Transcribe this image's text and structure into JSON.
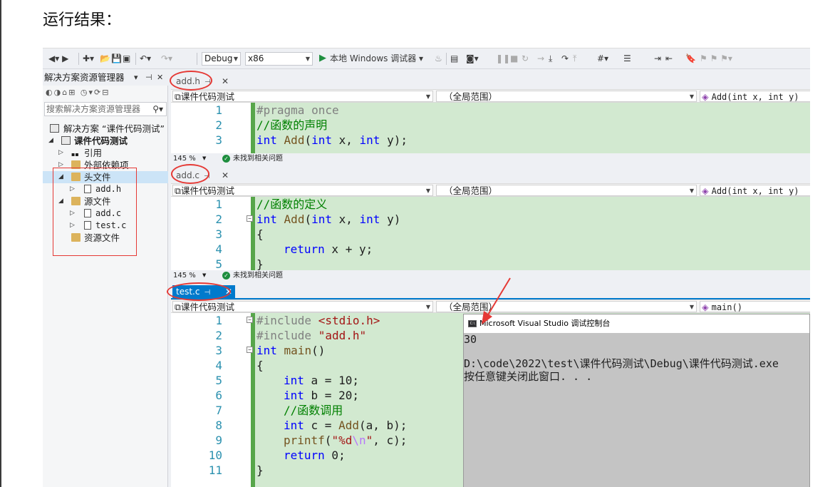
{
  "article_title": "运行结果：",
  "toolbar": {
    "config": "Debug",
    "platform": "x86",
    "run_label": "本地 Windows 调试器",
    "run_dropdown": "▾"
  },
  "solution_explorer": {
    "title": "解决方案资源管理器",
    "search_placeholder": "搜索解决方案资源管理器",
    "items": [
      {
        "label": "解决方案 “课件代码测试”",
        "bold": false
      },
      {
        "label": "课件代码测试",
        "bold": true
      },
      {
        "label": "引用",
        "bold": false
      },
      {
        "label": "外部依赖项",
        "bold": false
      },
      {
        "label": "头文件",
        "bold": false
      },
      {
        "label": "add.h",
        "bold": false
      },
      {
        "label": "源文件",
        "bold": false
      },
      {
        "label": "add.c",
        "bold": false
      },
      {
        "label": "test.c",
        "bold": false
      },
      {
        "label": "资源文件",
        "bold": false
      }
    ]
  },
  "panes": [
    {
      "tab": "add.h",
      "nav_project": "课件代码测试",
      "nav_scope": "（全局范围）",
      "nav_member": "Add(int x, int y)",
      "lines": [
        "1",
        "2",
        "3"
      ],
      "zoom": "145 %",
      "status": "未找到相关问题"
    },
    {
      "tab": "add.c",
      "nav_project": "课件代码测试",
      "nav_scope": "（全局范围）",
      "nav_member": "Add(int x, int y)",
      "lines": [
        "1",
        "2",
        "3",
        "4",
        "5"
      ],
      "zoom": "145 %",
      "status": "未找到相关问题"
    },
    {
      "tab": "test.c",
      "nav_project": "课件代码测试",
      "nav_scope": "（全局范围）",
      "nav_member": "main()",
      "lines": [
        "1",
        "2",
        "3",
        "4",
        "5",
        "6",
        "7",
        "8",
        "9",
        "10",
        "11"
      ]
    }
  ],
  "code": {
    "addh": {
      "l1": "#pragma once",
      "l2": "//函数的声明",
      "l3_kw1": "int",
      "l3_fn": "Add",
      "l3_a": "(",
      "l3_kw2": "int",
      "l3_b": " x, ",
      "l3_kw3": "int",
      "l3_c": " y);"
    },
    "addc": {
      "l1": "//函数的定义",
      "l2_kw1": "int",
      "l2_fn": "Add",
      "l2_a": "(",
      "l2_kw2": "int",
      "l2_b": " x, ",
      "l2_kw3": "int",
      "l2_c": " y)",
      "l3": "{",
      "l4_kw": "return",
      "l4_rest": " x + y;",
      "l5": "}"
    },
    "testc": {
      "l1_pp": "#include ",
      "l1_st": "<stdio.h>",
      "l2_pp": "#include ",
      "l2_st": "\"add.h\"",
      "l3_kw": "int",
      "l3_fn": " main",
      "l3_rest": "()",
      "l4": "{",
      "l5_kw": "int",
      "l5_rest": " a = 10;",
      "l6_kw": "int",
      "l6_rest": " b = 20;",
      "l7": "//函数调用",
      "l8_kw": "int",
      "l8_a": " c = ",
      "l8_fn": "Add",
      "l8_b": "(a, b);",
      "l9_fn": "printf",
      "l9_a": "(",
      "l9_st1": "\"%d",
      "l9_esc": "\\n",
      "l9_st2": "\"",
      "l9_b": ", c);",
      "l10_kw": "return",
      "l10_rest": " 0;",
      "l11": "}"
    }
  },
  "console": {
    "title": "Microsoft Visual Studio 调试控制台",
    "icon_text": "C:\\",
    "output": "30",
    "path_line": "D:\\code\\2022\\test\\课件代码测试\\Debug\\课件代码测试.exe",
    "close_line": "按任意键关闭此窗口. . ."
  },
  "colors": {
    "accent": "#007acc",
    "highlight_red": "#e53935",
    "code_bg": "#d2e9d0",
    "keyword": "#0000ff",
    "comment": "#008000"
  }
}
